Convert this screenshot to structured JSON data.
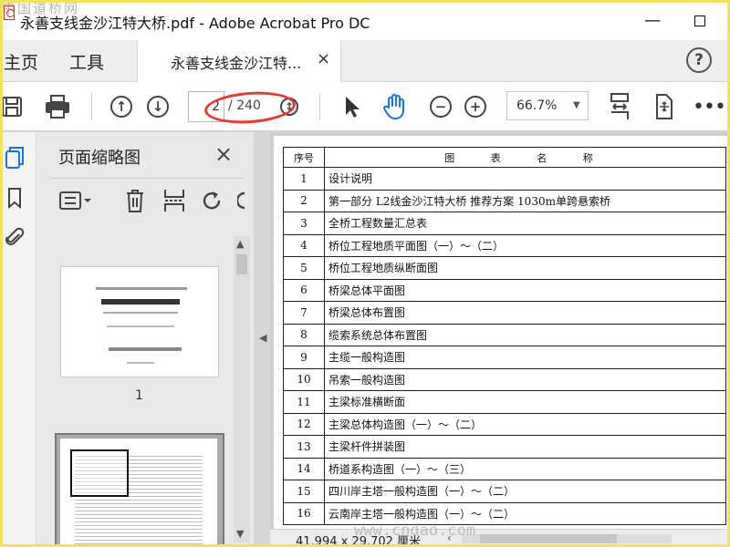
{
  "window": {
    "title": "永善支线金沙江特大桥.pdf - Adobe Acrobat Pro DC",
    "watermark_top": "中国道桥网",
    "minimize_label": "—"
  },
  "nav": {
    "home_label": "主页",
    "tools_label": "工具",
    "document_tab_label": "永善支线金沙江特...",
    "document_tab_close": "×",
    "help_label": "?"
  },
  "toolbar": {
    "page_current": "2",
    "page_total": "/ 240",
    "zoom_value": "66.7%",
    "icons": [
      "save-icon",
      "print-icon",
      "prev-page-icon",
      "next-page-icon",
      "select-cursor-icon",
      "hand-tool-icon",
      "zoom-out-icon",
      "zoom-in-icon",
      "fit-page-icon",
      "rotate-view-icon",
      "more-icon"
    ]
  },
  "sidebar": {
    "panel_title": "页面缩略图",
    "close_label": "×",
    "thumbnails": [
      {
        "page_label": "1"
      }
    ]
  },
  "document": {
    "columns": {
      "index": "序号",
      "title": "图 表 名 称"
    },
    "rows": [
      {
        "index": "1",
        "title": "设计说明"
      },
      {
        "index": "2",
        "title": "第一部分 L2线金沙江特大桥 推荐方案 1030m单跨悬索桥"
      },
      {
        "index": "3",
        "title": "全桥工程数量汇总表"
      },
      {
        "index": "4",
        "title": "桥位工程地质平面图（一）～（二）"
      },
      {
        "index": "5",
        "title": "桥位工程地质纵断面图"
      },
      {
        "index": "6",
        "title": "桥梁总体平面图"
      },
      {
        "index": "7",
        "title": "桥梁总体布置图"
      },
      {
        "index": "8",
        "title": "缆索系统总体布置图"
      },
      {
        "index": "9",
        "title": "主缆一般构造图"
      },
      {
        "index": "10",
        "title": "吊索一般构造图"
      },
      {
        "index": "11",
        "title": "主梁标准横断面"
      },
      {
        "index": "12",
        "title": "主梁总体构造图（一）～（二）"
      },
      {
        "index": "13",
        "title": "主梁杆件拼装图"
      },
      {
        "index": "14",
        "title": "桥道系构造图（一）～（三）"
      },
      {
        "index": "15",
        "title": "四川岸主塔一般构造图（一）～（二）"
      },
      {
        "index": "16",
        "title": "云南岸主塔一般构造图（一）～（二）"
      }
    ]
  },
  "status": {
    "page_size": "41.994 x 29.702 厘米",
    "watermark_bottom": "www.cndao.com"
  },
  "colors": {
    "annotation_red": "#e53b30",
    "frame_yellow": "#f3e25a",
    "hand_tool_blue": "#1473e6",
    "thumbnail_icon_blue": "#1473e6"
  }
}
